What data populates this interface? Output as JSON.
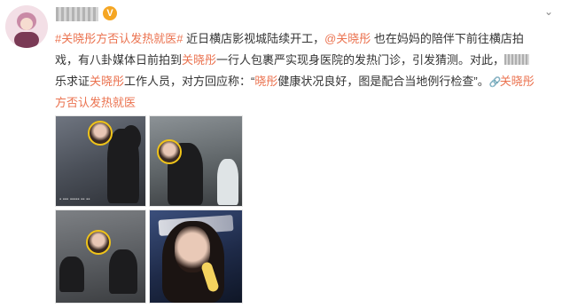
{
  "post": {
    "line1": {
      "topic": "#关晓彤方否认发热就医#",
      "text1": " 近日横店影视城陆续开工，",
      "mention": "@关晓彤",
      "text2": " 也在妈妈的陪伴下前往横店拍"
    },
    "line2": {
      "text1": "戏，有八卦媒体日前拍到",
      "name": "关晓彤",
      "text2": "一行人包裹严实现身医院的发热门诊，引发猜测。对此，"
    },
    "line3": {
      "text1": "乐求证",
      "name": "关晓彤",
      "text2": "工作人员，对方回应称：“",
      "name2": "晓彤",
      "text3": "健康状况良好，图是配合当地例行检查”。",
      "link": "关晓彤"
    },
    "line4": {
      "link": "方否认发热就医"
    }
  },
  "icons": {
    "verified": "verified-badge-icon",
    "chevron": "chevron-down-icon",
    "link": "link-icon"
  },
  "colors": {
    "accent": "#eb7350",
    "verified": "#f5a623",
    "face_circle": "#f0c419"
  }
}
